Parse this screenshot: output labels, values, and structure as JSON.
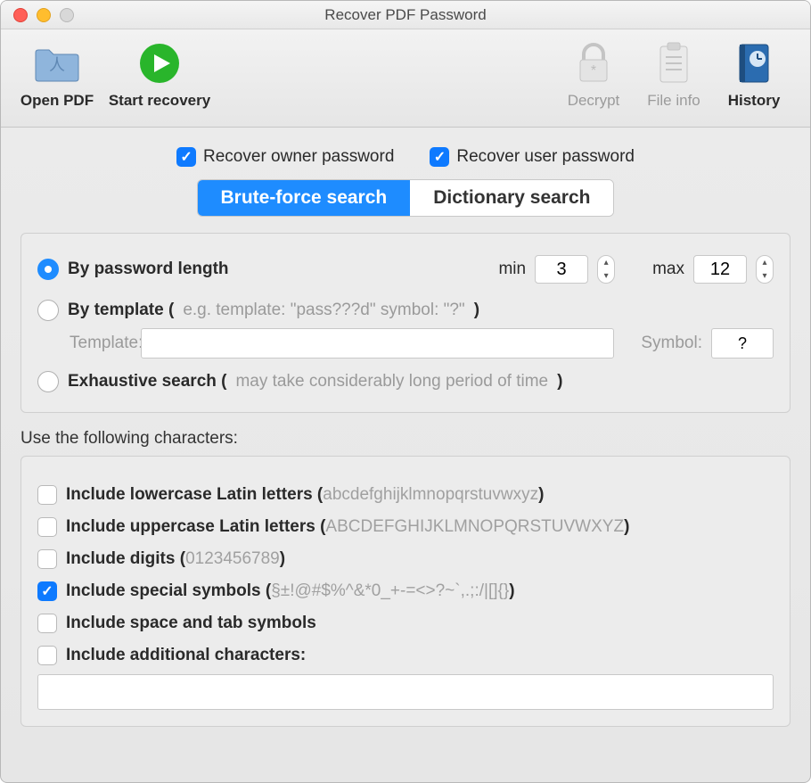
{
  "window": {
    "title": "Recover PDF Password"
  },
  "toolbar": {
    "open_pdf": "Open PDF",
    "start_recovery": "Start recovery",
    "decrypt": "Decrypt",
    "file_info": "File info",
    "history": "History"
  },
  "checks": {
    "owner_label": "Recover owner password",
    "user_label": "Recover user password",
    "owner_on": true,
    "user_on": true
  },
  "seg": {
    "brute": "Brute-force search",
    "dict": "Dictionary search"
  },
  "bylen": {
    "label": "By password length",
    "min_label": "min",
    "max_label": "max",
    "min": "3",
    "max": "12"
  },
  "bytmpl": {
    "label": "By template (",
    "hint": "e.g. template: \"pass???d\" symbol: \"?\"",
    "close": ")",
    "tmpl_label": "Template:",
    "symbol_label": "Symbol:",
    "symbol_value": "?"
  },
  "exh": {
    "label": "Exhaustive search (",
    "hint": "may take considerably long period of time",
    "close": ")"
  },
  "chars_heading": "Use the following characters:",
  "chars": {
    "lower": {
      "label": "Include lowercase Latin letters (",
      "dim": "abcdefghijklmnopqrstuvwxyz",
      "close": ")"
    },
    "upper": {
      "label": "Include uppercase Latin letters (",
      "dim": "ABCDEFGHIJKLMNOPQRSTUVWXYZ",
      "close": ")"
    },
    "digits": {
      "label": "Include digits (",
      "dim": "0123456789",
      "close": ")"
    },
    "special": {
      "label": "Include special symbols (",
      "dim": "§±!@#$%^&*0_+-=<>?~`,.;:/|[]{}",
      "close": ")"
    },
    "space": {
      "label": "Include space and tab symbols"
    },
    "addl": {
      "label": "Include additional characters:"
    }
  }
}
